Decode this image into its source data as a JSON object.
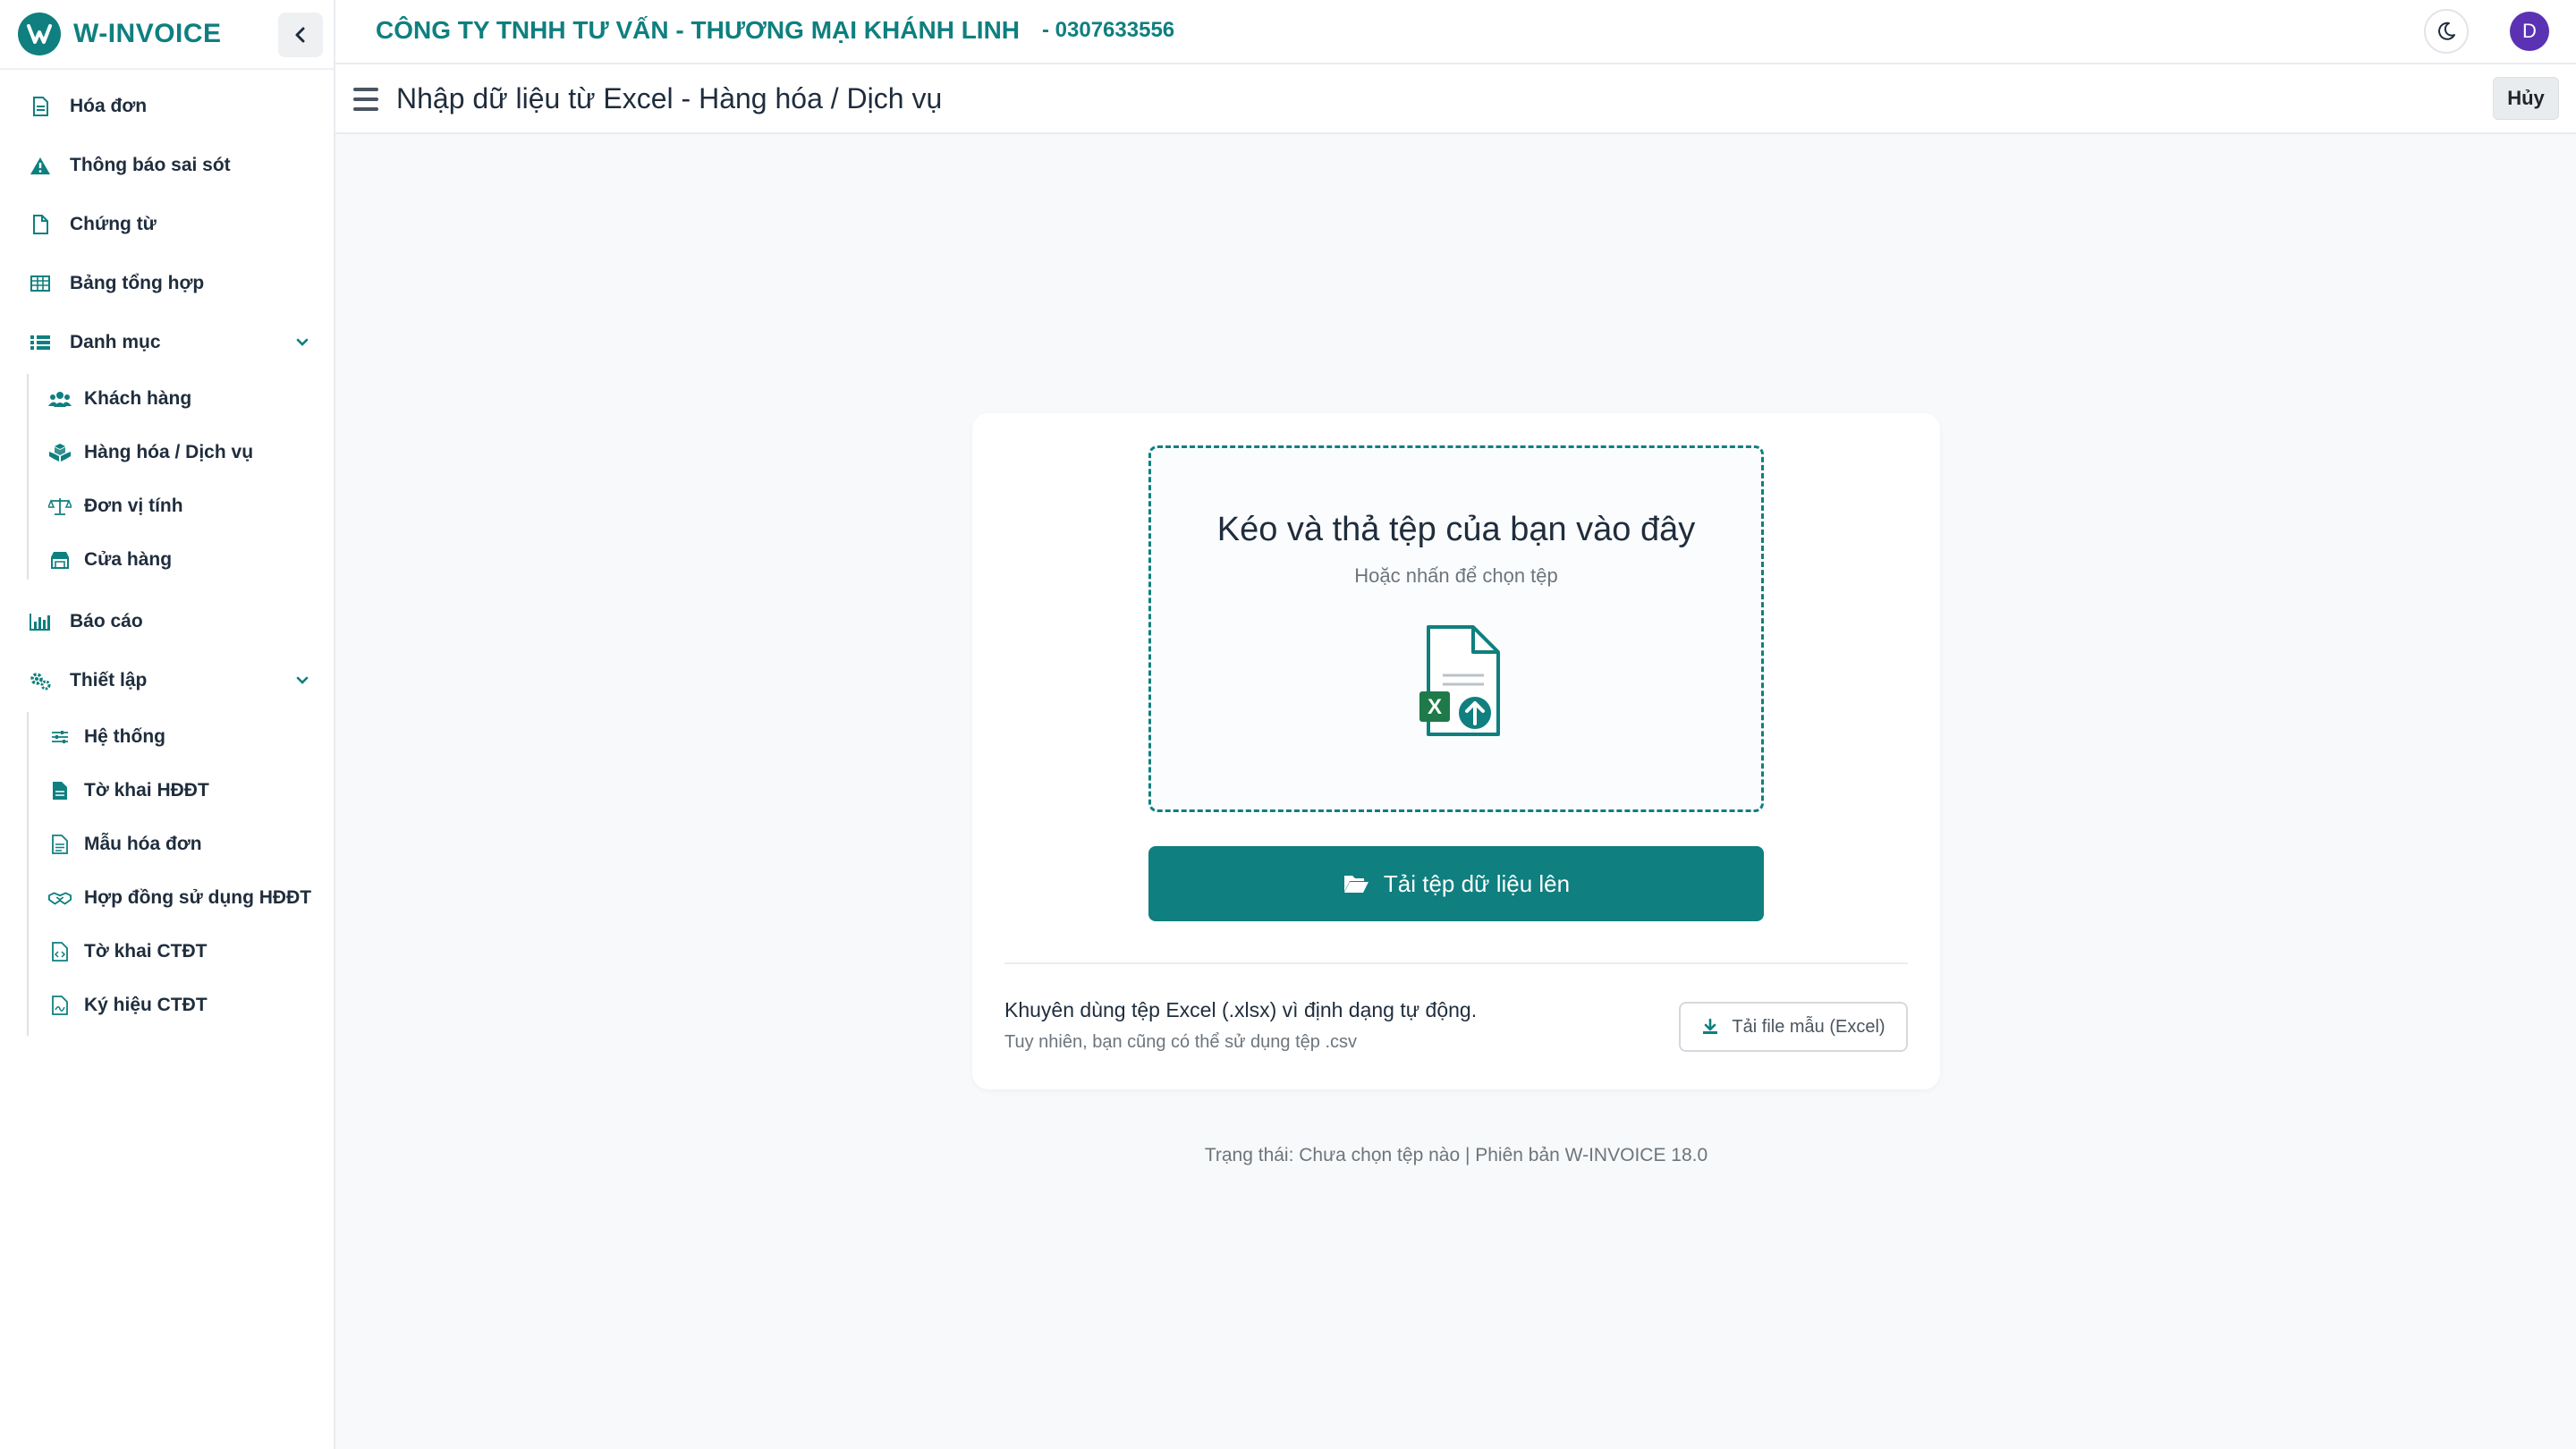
{
  "brand": {
    "name": "W-INVOICE",
    "accent": "#0f7f7f"
  },
  "sidebar": {
    "items": [
      {
        "label": "Hóa đơn",
        "icon": "invoice-icon"
      },
      {
        "label": "Thông báo sai sót",
        "icon": "warning-icon"
      },
      {
        "label": "Chứng từ",
        "icon": "document-icon"
      },
      {
        "label": "Bảng tổng hợp",
        "icon": "table-icon"
      },
      {
        "label": "Danh mục",
        "icon": "list-icon",
        "expanded": true,
        "children": [
          {
            "label": "Khách hàng",
            "icon": "users-icon"
          },
          {
            "label": "Hàng hóa / Dịch vụ",
            "icon": "cubes-icon"
          },
          {
            "label": "Đơn vị tính",
            "icon": "scale-icon"
          },
          {
            "label": "Cửa hàng",
            "icon": "store-icon"
          }
        ]
      },
      {
        "label": "Báo cáo",
        "icon": "chart-icon"
      },
      {
        "label": "Thiết lập",
        "icon": "gears-icon",
        "expanded": true,
        "children": [
          {
            "label": "Hệ thống",
            "icon": "sliders-icon"
          },
          {
            "label": "Tờ khai HĐĐT",
            "icon": "file-filled-icon"
          },
          {
            "label": "Mẫu hóa đơn",
            "icon": "file-lines-icon"
          },
          {
            "label": "Hợp đồng sử dụng HĐĐT",
            "icon": "handshake-icon"
          },
          {
            "label": "Tờ khai CTĐT",
            "icon": "file-code-icon"
          },
          {
            "label": "Ký hiệu CTĐT",
            "icon": "file-sign-icon"
          }
        ]
      }
    ]
  },
  "header": {
    "company": "CÔNG TY TNHH TƯ VẤN - THƯƠNG MẠI KHÁNH LINH",
    "taxcode": "- 0307633556",
    "avatar_letter": "D",
    "avatar_color": "#5b32b4"
  },
  "page": {
    "title": "Nhập dữ liệu từ Excel - Hàng hóa / Dịch vụ",
    "cancel_label": "Hủy"
  },
  "upload": {
    "drop_title": "Kéo và thả tệp của bạn vào đây",
    "drop_subtitle": "Hoặc nhấn để chọn tệp",
    "upload_button": "Tải tệp dữ liệu lên",
    "hint_main": "Khuyên dùng tệp Excel (.xlsx) vì định dạng tự động.",
    "hint_sub": "Tuy nhiên, bạn cũng có thể sử dụng tệp .csv",
    "sample_button": "Tải file mẫu (Excel)",
    "file_icon_letter": "X"
  },
  "status": {
    "text": "Trạng thái: Chưa chọn tệp nào | Phiên bản W-INVOICE 18.0"
  }
}
